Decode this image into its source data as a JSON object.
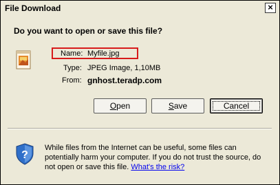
{
  "window": {
    "title": "File Download",
    "close_label": "×"
  },
  "prompt": {
    "question": "Do you want to open or save this file?"
  },
  "file": {
    "name_label": "Name:",
    "name_value": "Myfile.jpg",
    "type_label": "Type:",
    "type_value": "JPEG Image, 1,10MB",
    "from_label": "From:",
    "from_value": "gnhost.teradp.com",
    "icon": "jpeg-file-icon"
  },
  "buttons": {
    "open_label_mnemonic": "O",
    "open_label_rest": "pen",
    "save_label_mnemonic": "S",
    "save_label_rest": "ave",
    "cancel_label": "Cancel"
  },
  "warning": {
    "text": "While files from the Internet can be useful, some files can potentially harm your computer. If you do not trust the source, do not open or save this file.",
    "link_text": "What's the risk?",
    "icon": "shield-warning-icon"
  },
  "colors": {
    "highlight_box": "#d71a1a",
    "dialog_bg": "#ece9d8",
    "link": "#0000ee"
  }
}
